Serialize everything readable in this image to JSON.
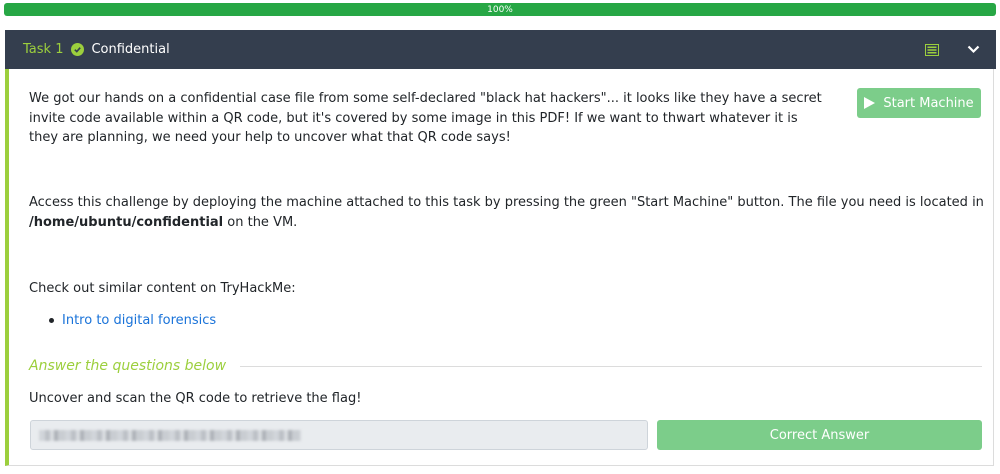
{
  "progress": {
    "percent_label": "100%",
    "value": 100
  },
  "task": {
    "number_label": "Task 1",
    "title": "Confidential",
    "start_machine_label": "Start Machine",
    "paragraph1": "We got our hands on a confidential case file from some self-declared \"black hat hackers\"... it looks like they have a secret invite code available within a QR code, but it's covered by some image in this PDF! If we want to thwart whatever it is they are planning, we need your help to uncover what that QR code says!",
    "paragraph2_prefix": "Access this challenge by deploying the machine attached to this task by pressing the green \"Start Machine\" button. The file you need is located in ",
    "paragraph2_path": "/home/ubuntu/confidential",
    "paragraph2_suffix": " on the VM.",
    "paragraph3": "Check out similar content on TryHackMe:",
    "link_label": "Intro to digital forensics"
  },
  "answers": {
    "heading": "Answer the questions below",
    "question": "Uncover and scan the QR code to retrieve the flag!",
    "answer_value": "(blurred)",
    "submit_label": "Correct Answer"
  },
  "colors": {
    "accent_green": "#9ccf3d",
    "header_bg": "#343e4e",
    "button_green": "#7ccd8a",
    "link_blue": "#1a73d9",
    "progress_green": "#27a745"
  },
  "icons": [
    "check-circle-icon",
    "list-icon",
    "chevron-down-icon",
    "play-icon"
  ]
}
